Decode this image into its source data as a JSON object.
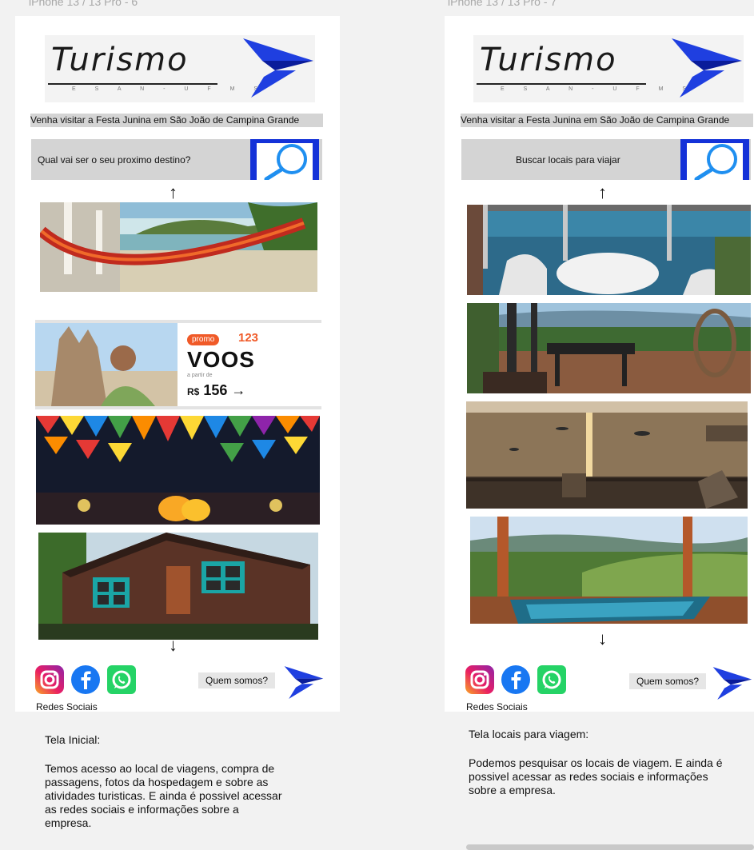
{
  "frames": [
    {
      "label": "iPhone 13 / 13 Pro - 6",
      "logo": {
        "title": "Turismo",
        "subtitle": "E S A N - U F M S"
      },
      "banner": "Venha visitar a Festa Junina em São João de Campina Grande",
      "search": {
        "text": "Qual vai ser o seu proximo destino?",
        "icon": "magnifier-icon"
      },
      "promo": {
        "badge": "promo",
        "number": "123",
        "headline": "VOOS",
        "small": "a partir de",
        "currency": "R$",
        "price": "156",
        "arrow": "→"
      },
      "social_label": "Redes Sociais",
      "about_label": "Quem somos?",
      "description_title": "Tela Inicial:",
      "description_body": "Temos acesso ao local de viagens, compra de passagens, fotos da hospedagem e sobre as atividades turisticas. E ainda é possivel acessar as redes sociais e informações sobre a empresa."
    },
    {
      "label": "iPhone 13 / 13 Pro - 7",
      "logo": {
        "title": "Turismo",
        "subtitle": "E S A N - U F M S"
      },
      "banner": "Venha visitar a Festa Junina em São João de Campina Grande",
      "search": {
        "text": "Buscar locais  para viajar",
        "icon": "magnifier-icon"
      },
      "social_label": "Redes Sociais",
      "about_label": "Quem somos?",
      "description_title": "Tela locais para viagem:",
      "description_body": "Podemos pesquisar os locais de viagem. E ainda é possivel acessar as redes sociais e informações  sobre a empresa."
    }
  ],
  "icons": {
    "arrow_up": "↑",
    "arrow_down": "↓",
    "social": [
      "instagram-icon",
      "facebook-icon",
      "whatsapp-icon"
    ]
  },
  "colors": {
    "brand_blue": "#1432d8",
    "promo_orange": "#f05a28",
    "search_gray": "#d4d4d4"
  }
}
